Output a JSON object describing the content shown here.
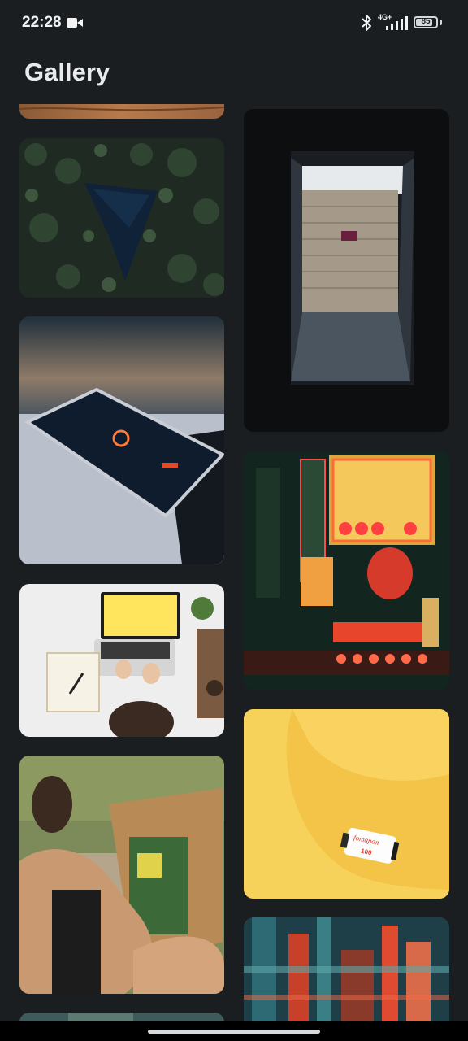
{
  "status_bar": {
    "time": "22:28",
    "network_label": "4G+",
    "battery": "85",
    "battery_level_percent": 85,
    "icons": [
      "video-camera-icon",
      "bluetooth-icon",
      "signal-icon",
      "battery-icon"
    ]
  },
  "header": {
    "title": "Gallery"
  },
  "gallery": {
    "photos": [
      {
        "id": "wood-surface",
        "description": "Wooden surface (partially visible)"
      },
      {
        "id": "forest-lake",
        "description": "Aerial view of pine forest with dark lake"
      },
      {
        "id": "stadium-tunnel",
        "description": "Dark tunnel opening to stadium seats"
      },
      {
        "id": "phone-threads",
        "description": "Smartphone showing Threads logo on laptop"
      },
      {
        "id": "neon-street",
        "description": "Japanese neon street signs at night"
      },
      {
        "id": "laptop-desk",
        "description": "Person working on laptop at white desk"
      },
      {
        "id": "film-canister",
        "description": "Fomapan film canister on yellow paper"
      },
      {
        "id": "painter-easel",
        "description": "Woman painting on easel outdoors"
      },
      {
        "id": "abstract-glitch",
        "description": "Abstract colorful glitch art"
      },
      {
        "id": "partial-bottom",
        "description": "Partially visible photo"
      }
    ],
    "film_label": "fomapan",
    "film_iso": "100"
  }
}
